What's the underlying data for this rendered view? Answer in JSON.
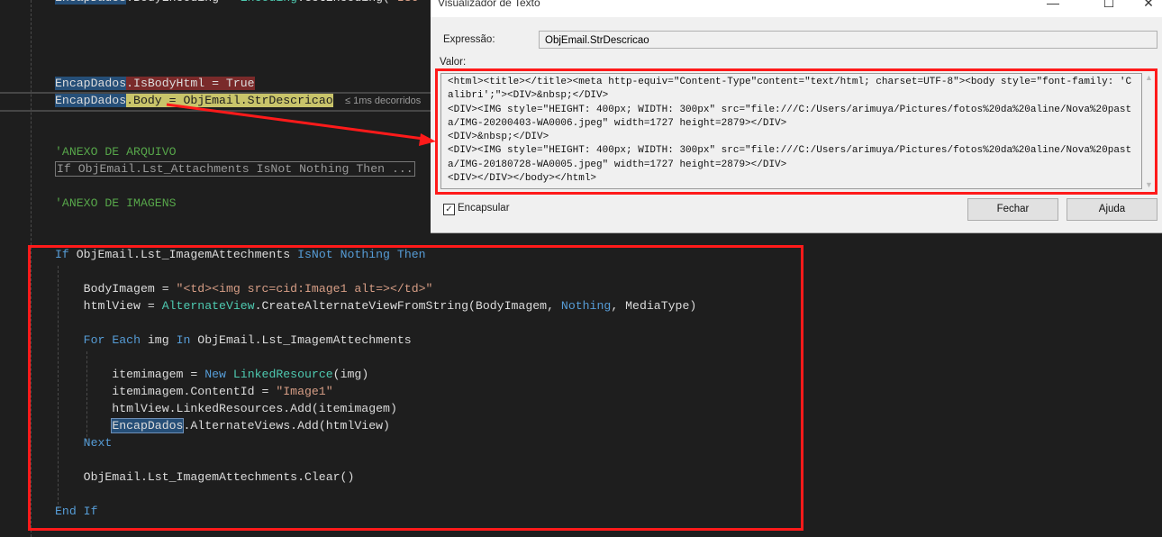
{
  "editor": {
    "lines": [
      [
        [
          "EncapDados",
          "hl"
        ],
        [
          ".BodyEncoding = ",
          ""
        ],
        [
          "Encoding",
          "ty"
        ],
        [
          ".GetEncoding(\"",
          ""
        ],
        [
          "ISO",
          "st"
        ]
      ],
      [],
      [],
      [],
      [],
      [
        [
          "EncapDados",
          "hl"
        ],
        [
          ".IsBodyHtml = True",
          "brk"
        ]
      ],
      [
        [
          "EncapDados",
          "hl"
        ],
        [
          ".Body = ObjEmail.StrDescricao",
          "cur"
        ]
      ],
      [],
      [],
      [
        [
          "'ANEXO DE ARQUIVO",
          "cm"
        ]
      ],
      [
        [
          "If ObjEmail.Lst_Attachments IsNot Nothing Then ...",
          "fold"
        ]
      ],
      [],
      [
        [
          "'ANEXO DE IMAGENS",
          "cm"
        ]
      ],
      [],
      [],
      [
        [
          "If",
          "kw"
        ],
        [
          " ObjEmail.Lst_ImagemAttechments ",
          ""
        ],
        [
          "IsNot",
          "kw"
        ],
        [
          " ",
          ""
        ],
        [
          "Nothing",
          "kw"
        ],
        [
          " ",
          ""
        ],
        [
          "Then",
          "kw"
        ]
      ],
      [],
      [
        [
          "    BodyImagem = ",
          ""
        ],
        [
          "\"<td><img src=cid:Image1 alt=></td>\"",
          "st"
        ]
      ],
      [
        [
          "    htmlView = ",
          ""
        ],
        [
          "AlternateView",
          "ty"
        ],
        [
          ".CreateAlternateViewFromString(BodyImagem, ",
          ""
        ],
        [
          "Nothing",
          "kw"
        ],
        [
          ", MediaType)",
          ""
        ]
      ],
      [],
      [
        [
          "    ",
          ""
        ],
        [
          "For",
          "kw"
        ],
        [
          " ",
          ""
        ],
        [
          "Each",
          "kw"
        ],
        [
          " img ",
          ""
        ],
        [
          "In",
          "kw"
        ],
        [
          " ObjEmail.Lst_ImagemAttechments",
          ""
        ]
      ],
      [],
      [
        [
          "        itemimagem = ",
          ""
        ],
        [
          "New",
          "kw"
        ],
        [
          " ",
          ""
        ],
        [
          "LinkedResource",
          "ty"
        ],
        [
          "(img)",
          ""
        ]
      ],
      [
        [
          "        itemimagem.ContentId = ",
          ""
        ],
        [
          "\"Image1\"",
          "st"
        ]
      ],
      [
        [
          "        htmlView.LinkedResources.Add(itemimagem)",
          ""
        ]
      ],
      [
        [
          "        ",
          ""
        ],
        [
          "EncapDados",
          "hlb"
        ],
        [
          ".AlternateViews.Add(htmlView)",
          ""
        ]
      ],
      [
        [
          "    ",
          ""
        ],
        [
          "Next",
          "kw"
        ]
      ],
      [],
      [
        [
          "    ObjEmail.Lst_ImagemAttechments.Clear()",
          ""
        ]
      ],
      [],
      [
        [
          "End",
          "kw"
        ],
        [
          " ",
          ""
        ],
        [
          "If",
          "kw"
        ]
      ]
    ],
    "elapsed": "≤ 1ms decorridos"
  },
  "dialog": {
    "title": "Visualizador de Texto",
    "minimize": "—",
    "maximize": "☐",
    "close": "✕",
    "expression_label": "Expressão:",
    "expression_value": "ObjEmail.StrDescricao",
    "value_label": "Valor:",
    "value_text": "<html><title></title><meta http-equiv=\"Content-Type\"content=\"text/html; charset=UTF-8\"><body style=\"font-family: 'Calibri';\"><DIV>&nbsp;</DIV>\n<DIV><IMG style=\"HEIGHT: 400px; WIDTH: 300px\" src=\"file:///C:/Users/arimuya/Pictures/fotos%20da%20aline/Nova%20pasta/IMG-20200403-WA0006.jpeg\" width=1727 height=2879></DIV>\n<DIV>&nbsp;</DIV>\n<DIV><IMG style=\"HEIGHT: 400px; WIDTH: 300px\" src=\"file:///C:/Users/arimuya/Pictures/fotos%20da%20aline/Nova%20pasta/IMG-20180728-WA0005.jpeg\" width=1727 height=2879></DIV>\n<DIV></DIV></body></html>",
    "wrap_label": "Encapsular",
    "wrap_checked": true,
    "close_button": "Fechar",
    "help_button": "Ajuda"
  },
  "colors": {
    "annotation": "#ff1a1a",
    "keyword": "#569cd6",
    "type": "#4ec9b0",
    "string": "#d69d85",
    "comment": "#57a64a"
  }
}
